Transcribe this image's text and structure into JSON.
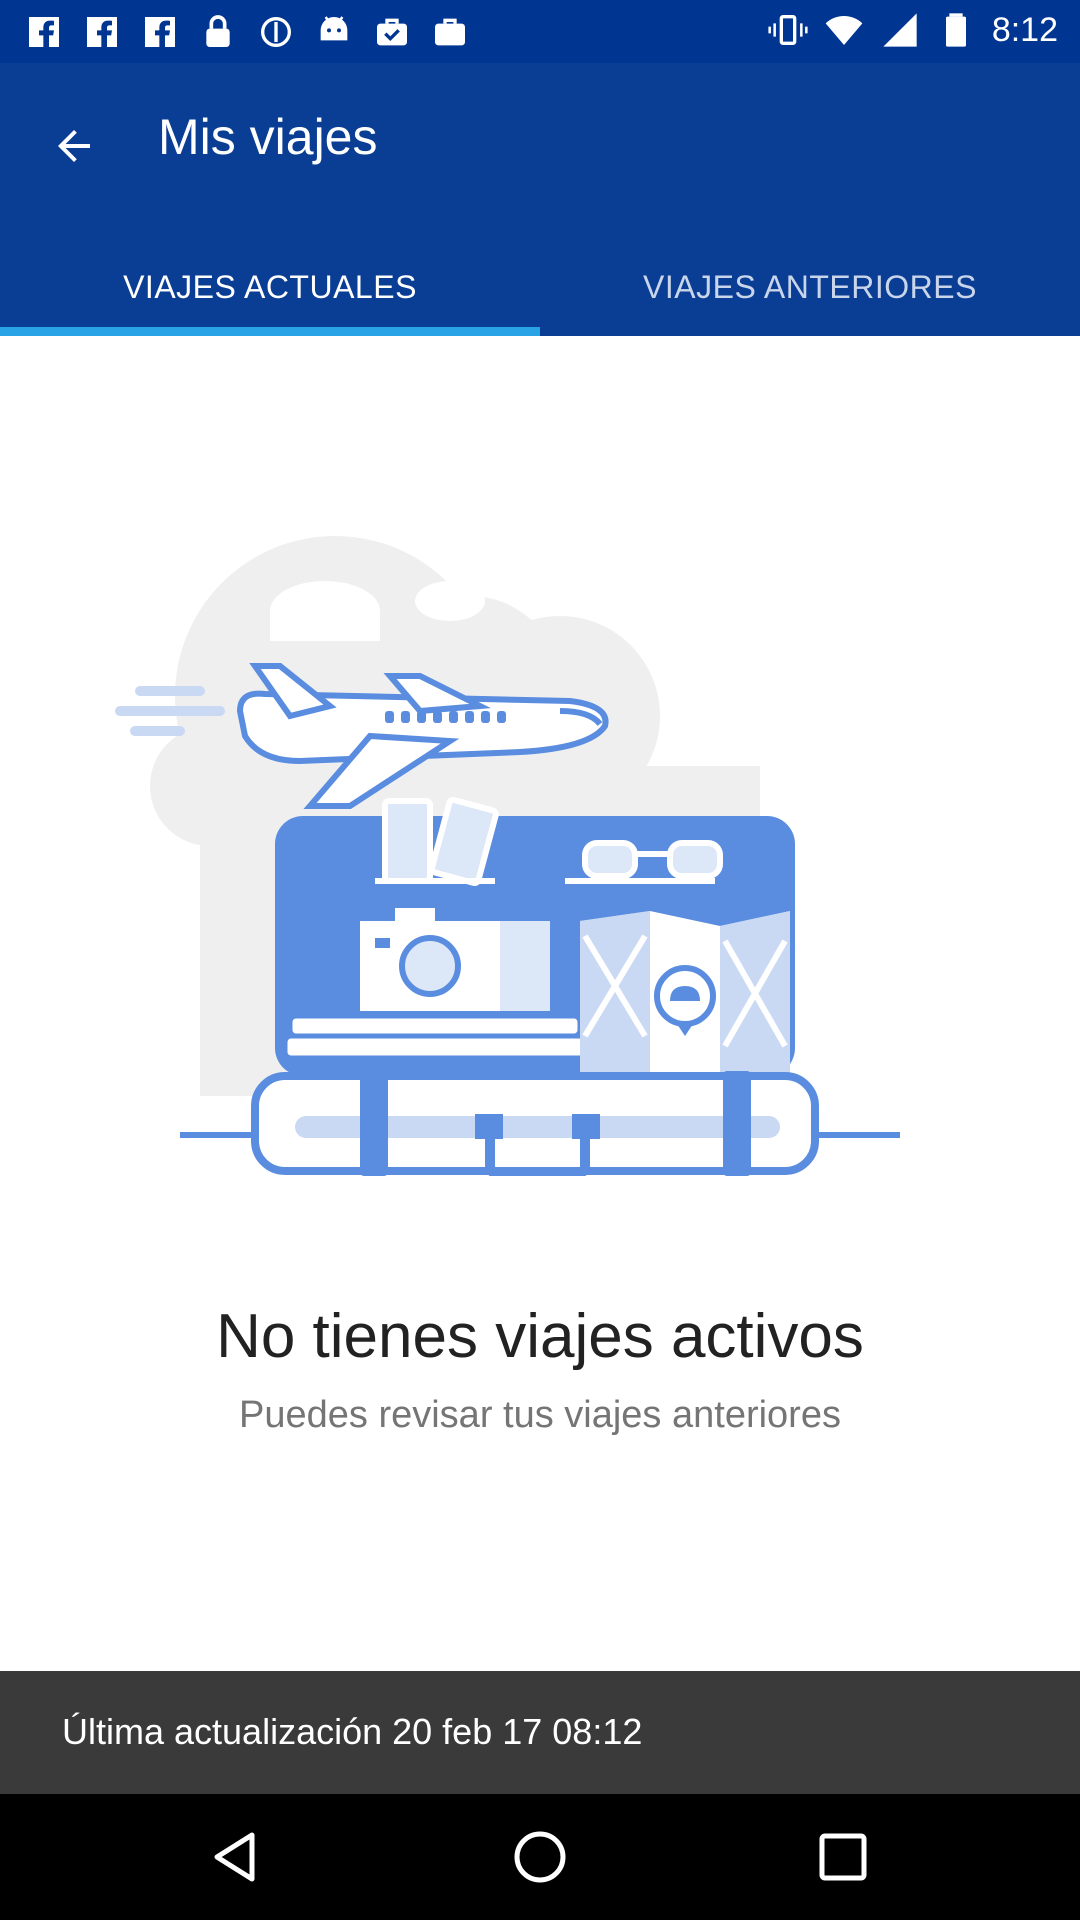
{
  "status_bar": {
    "time": "8:12",
    "icons": [
      "facebook-icon",
      "facebook-icon",
      "facebook-icon",
      "lock-icon",
      "settings-icon",
      "android-icon",
      "briefcase-check-icon",
      "briefcase-icon",
      "vibrate-icon",
      "wifi-icon",
      "signal-icon",
      "battery-icon"
    ]
  },
  "app_bar": {
    "title": "Mis viajes",
    "back_icon": "arrow-back-icon"
  },
  "tabs": [
    {
      "label": "VIAJES ACTUALES",
      "active": true
    },
    {
      "label": "VIAJES ANTERIORES",
      "active": false
    }
  ],
  "empty_state": {
    "illustration": "travel-suitcase-airplane-illustration",
    "title": "No tienes viajes activos",
    "subtitle": "Puedes revisar tus viajes anteriores"
  },
  "footer": {
    "last_update": "Última actualización 20 feb 17 08:12"
  },
  "nav_bar": {
    "buttons": [
      "back-triangle-icon",
      "home-circle-icon",
      "recents-square-icon"
    ]
  },
  "colors": {
    "app_bar": "#0a3d94",
    "status_bar": "#003591",
    "tab_indicator": "#29a3e6",
    "illustration_blue": "#5a8de0",
    "footer": "#3a3a3a"
  }
}
